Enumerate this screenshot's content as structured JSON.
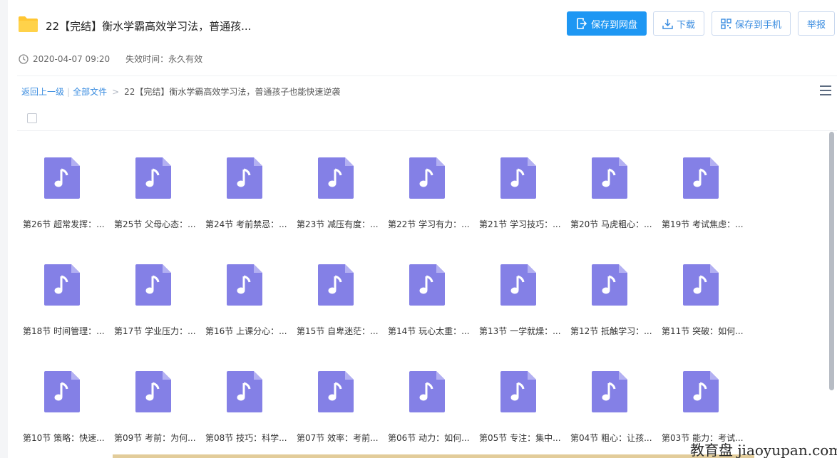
{
  "header": {
    "title": "22【完结】衡水学霸高效学习法，普通孩...",
    "buttons": {
      "save_to_disk": "保存到网盘",
      "download": "下载",
      "save_to_phone": "保存到手机",
      "report": "举报"
    }
  },
  "meta": {
    "date": "2020-04-07 09:20",
    "expiry": "失效时间：永久有效"
  },
  "breadcrumb": {
    "back": "返回上一级",
    "all_files": "全部文件",
    "current": "22【完结】衡水学霸高效学习法，普通孩子也能快速逆袭"
  },
  "files": [
    "第26节 超常发挥：...",
    "第25节 父母心态：...",
    "第24节 考前禁忌：...",
    "第23节 减压有度：...",
    "第22节 学习有力：...",
    "第21节 学习技巧：...",
    "第20节 马虎粗心：...",
    "第19节 考试焦虑：...",
    "第18节 时间管理：...",
    "第17节 学业压力：...",
    "第16节 上课分心：...",
    "第15节 自卑迷茫：...",
    "第14节 玩心太重：...",
    "第13节 一学就燥：...",
    "第12节 抵触学习：...",
    "第11节 突破：如何...",
    "第10节 策略：快速...",
    "第09节 考前：为何...",
    "第08节 技巧：科学...",
    "第07节 效率：考前...",
    "第06节 动力：如何...",
    "第05节 专注：集中...",
    "第04节 粗心：让孩...",
    "第03节 能力：考试..."
  ],
  "watermark": "教育盘 jiaoyupan.com",
  "icons": {
    "folder": "folder-icon",
    "clock": "clock-icon",
    "file": "music-file-icon",
    "menu": "list-view-icon"
  },
  "colors": {
    "primary": "#1e97f3",
    "link": "#3b8de0",
    "file_icon": "#8480e6",
    "folder": "#ffc632"
  }
}
